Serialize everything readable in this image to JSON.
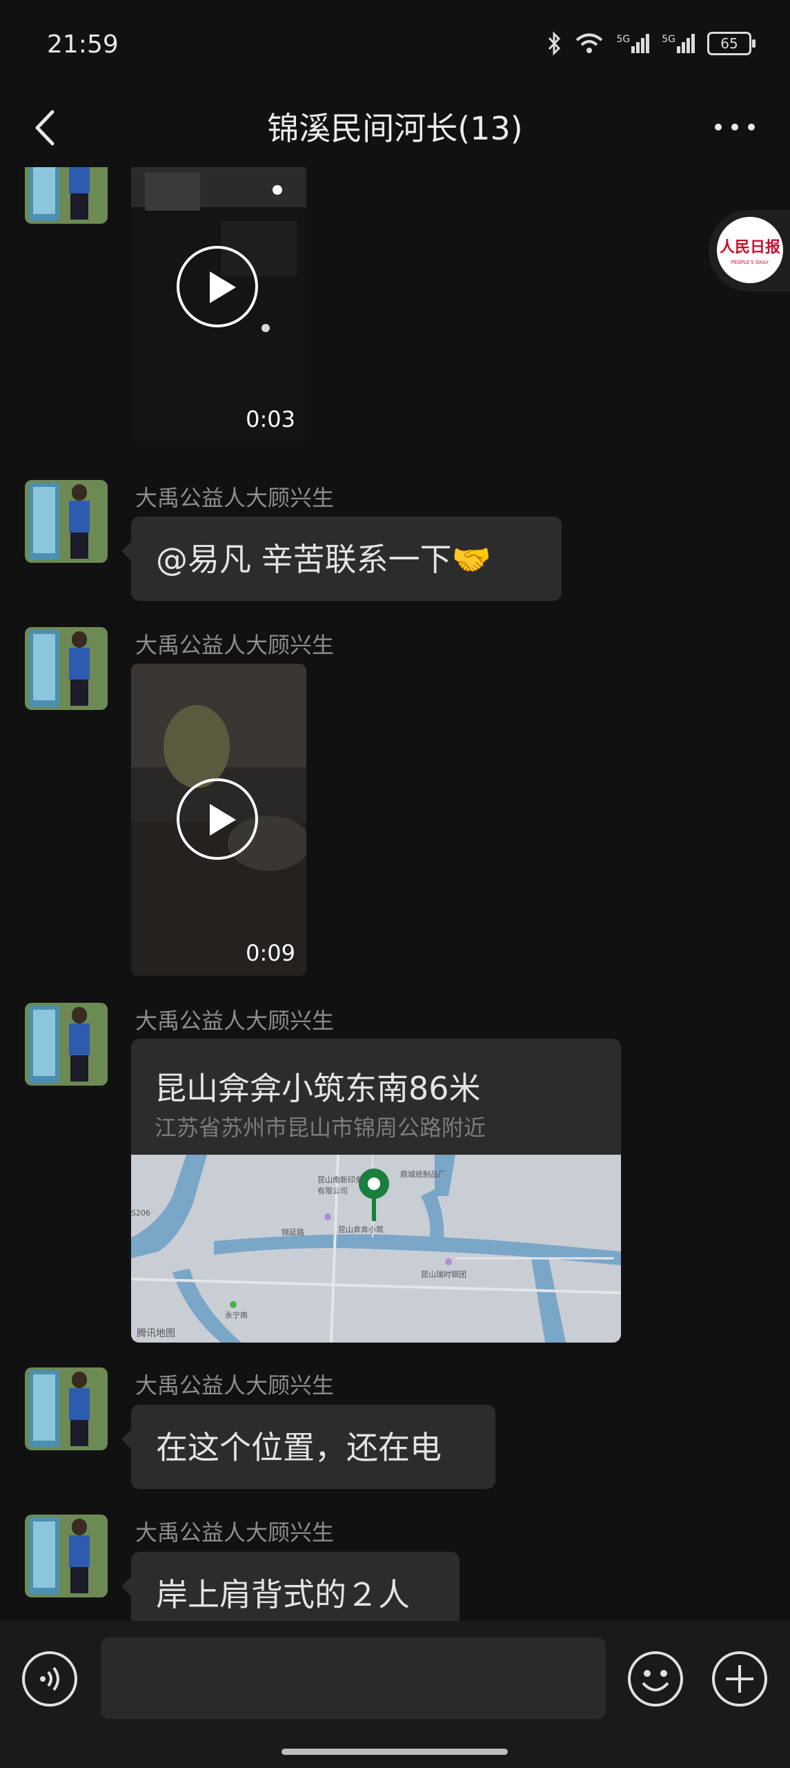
{
  "status_bar": {
    "time": "21:59",
    "network_1": "5G",
    "network_2": "5G",
    "battery": "65"
  },
  "header": {
    "title": "锦溪民间河长(13)"
  },
  "messages": [
    {
      "type": "video",
      "duration": "0:03"
    },
    {
      "type": "text",
      "sender": "大禹公益人大顾兴生",
      "text": "@易凡  辛苦联系一下🤝"
    },
    {
      "type": "video",
      "sender": "大禹公益人大顾兴生",
      "duration": "0:09"
    },
    {
      "type": "location",
      "sender": "大禹公益人大顾兴生",
      "title": "昆山弇弇小筑东南86米",
      "address": "江苏省苏州市昆山市锦周公路附近",
      "map_labels": [
        "昆山南新印务有限公司",
        "鼎城纸制品厂",
        "昆山弇弇小筑",
        "锦延路",
        "昆山瑞时钢团",
        "永宁南",
        "S206"
      ],
      "map_credit": "腾讯地图"
    },
    {
      "type": "text",
      "sender": "大禹公益人大顾兴生",
      "text": "在这个位置，还在电"
    },
    {
      "type": "text",
      "sender": "大禹公益人大顾兴生",
      "text": "岸上肩背式的２人"
    }
  ],
  "floating_logo": {
    "text_cn": "人民日报",
    "text_en": "PEOPLE'S DAILY"
  },
  "input_bar": {
    "placeholder": ""
  },
  "colors": {
    "background": "#111111",
    "bubble": "#2c2c2c",
    "map_pin": "#1a7f3c"
  }
}
